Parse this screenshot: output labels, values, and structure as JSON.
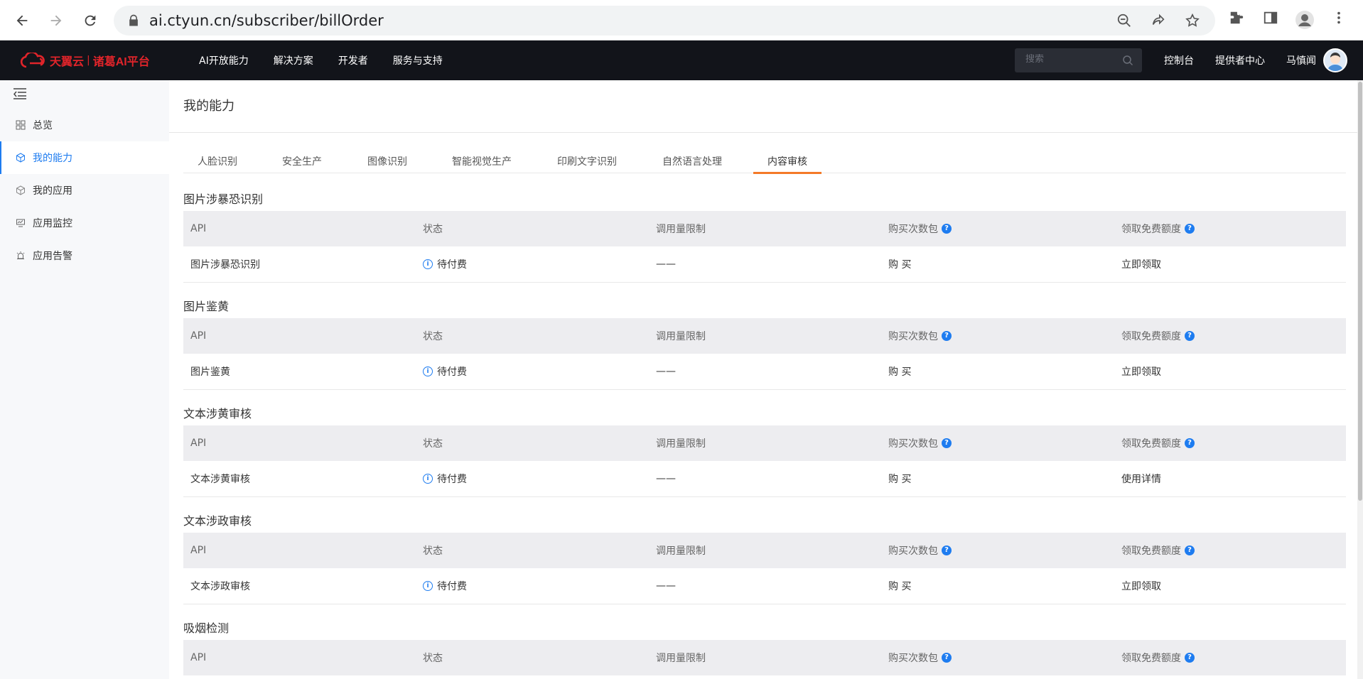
{
  "browser": {
    "url": "ai.ctyun.cn/subscriber/billOrder"
  },
  "header": {
    "logo_main": "天翼云",
    "logo_sep": "|",
    "logo_sub": "诸葛AI平台",
    "nav": [
      "AI开放能力",
      "解决方案",
      "开发者",
      "服务与支持"
    ],
    "search_placeholder": "搜索",
    "console": "控制台",
    "provider_center": "提供者中心",
    "username": "马慎闻"
  },
  "sidebar": {
    "items": [
      {
        "label": "总览",
        "icon": "grid-icon"
      },
      {
        "label": "我的能力",
        "icon": "cube-icon"
      },
      {
        "label": "我的应用",
        "icon": "cube-icon"
      },
      {
        "label": "应用监控",
        "icon": "monitor-icon"
      },
      {
        "label": "应用告警",
        "icon": "alarm-icon"
      }
    ]
  },
  "main": {
    "title": "我的能力",
    "tabs": [
      "人脸识别",
      "安全生产",
      "图像识别",
      "智能视觉生产",
      "印刷文字识别",
      "自然语言处理",
      "内容审核"
    ],
    "active_tab": "内容审核",
    "headers": {
      "api": "API",
      "status": "状态",
      "limit": "调用量限制",
      "buy": "购买次数包",
      "free": "领取免费额度"
    },
    "sections": [
      {
        "title": "图片涉暴恐识别",
        "row": {
          "api": "图片涉暴恐识别",
          "status": "待付费",
          "limit": "——",
          "buy": "购 买",
          "free": "立即领取"
        }
      },
      {
        "title": "图片鉴黄",
        "row": {
          "api": "图片鉴黄",
          "status": "待付费",
          "limit": "——",
          "buy": "购 买",
          "free": "立即领取"
        }
      },
      {
        "title": "文本涉黄审核",
        "row": {
          "api": "文本涉黄审核",
          "status": "待付费",
          "limit": "——",
          "buy": "购 买",
          "free": "使用详情"
        }
      },
      {
        "title": "文本涉政审核",
        "row": {
          "api": "文本涉政审核",
          "status": "待付费",
          "limit": "——",
          "buy": "购 买",
          "free": "立即领取"
        }
      },
      {
        "title": "吸烟检测"
      }
    ]
  },
  "colors": {
    "accent": "#1e7cf0",
    "tab_indicator": "#f47a28",
    "brand_red": "#e0242a",
    "header_bg": "#12141a"
  }
}
